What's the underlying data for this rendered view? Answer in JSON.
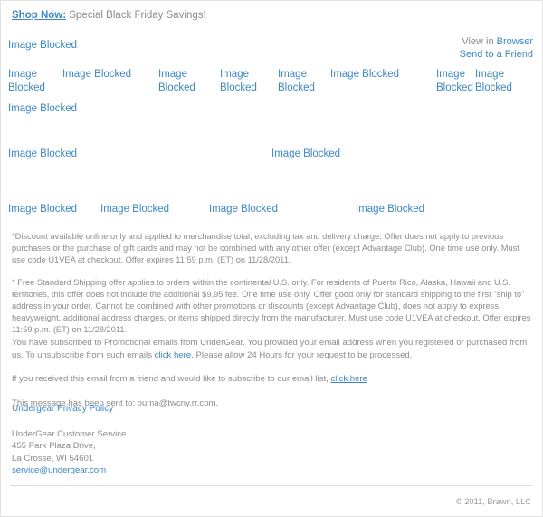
{
  "email": {
    "preheader": {
      "link_label": "Shop Now:",
      "text": " Special Black Friday Savings!"
    },
    "view_block": {
      "prefix": "View in ",
      "browser_link": "Browser",
      "send_link": "Send to a Friend"
    },
    "placeholder_label": "Image Blocked",
    "logo_placeholder": "Image Blocked",
    "nav_placeholders": [
      "Image Blocked",
      "Image Blocked",
      "Image Blocked",
      "Image Blocked",
      "Image Blocked",
      "Image Blocked",
      "Image Blocked",
      "Image Blocked"
    ],
    "banner_placeholder": "Image Blocked",
    "mid_placeholders": [
      "Image Blocked",
      "Image Blocked"
    ],
    "product_placeholders": [
      "Image Blocked",
      "Image Blocked",
      "Image Blocked",
      "Image Blocked"
    ],
    "fineprint": {
      "paragraph_1": "*Discount available online only and applied to merchandise total, excluding tax and delivery charge. Offer does not apply to previous purchases or the purchase of gift cards and may not be combined with any other offer (except Advantage Club). One time use only. Must use code U1VEA at checkout. Offer expires 11:59 p.m. (ET) on 11/28/2011.",
      "paragraph_2": "* Free Standard Shipping offer applies to orders within the continental U.S. only. For residents of Puerto Rico, Alaska, Hawaii and U.S. territories, this offer does not include the additional $9.95 fee. One time use only. Offer good only for standard shipping to the first \"ship to\" address in your order. Cannot be combined with other promotions or discounts (except Advantage Club), does not apply to express, heavyweight, additional address charges, or items shipped directly from the manufacturer. Must use code U1VEA at checkout. Offer expires 11:59 p.m. (ET) on 11/28/2011."
    },
    "notices": {
      "subscribe_part_1": "You have subscribed to Promotional emails from UnderGear. You provided your email address when you registered or purchased from us. To unsubscribe from such emails ",
      "subscribe_link": "click here",
      "subscribe_part_2": ". Please allow 24 Hours for your request to be processed.",
      "friend_part_1": "If you received this email from a friend and would like to subscribe to our email list, ",
      "friend_link": "click here",
      "sent_to": "This message has been sent to: puma@twcny.rr.com."
    },
    "footer": {
      "privacy_policy": "Undergear Privacy Policy",
      "company": "UnderGear Customer Service",
      "street": "455 Park Plaza Drive,",
      "city_state_zip": "La Crosse, WI 54601",
      "email": "service@undergear.com",
      "copyright": "© 2011, Brawn, LLC"
    },
    "colors": {
      "link_blue": "#3c87c4",
      "body_gray": "#8c8c8c",
      "border_gray": "#e2e2e2",
      "rule_gray": "#dcdcdc"
    }
  }
}
